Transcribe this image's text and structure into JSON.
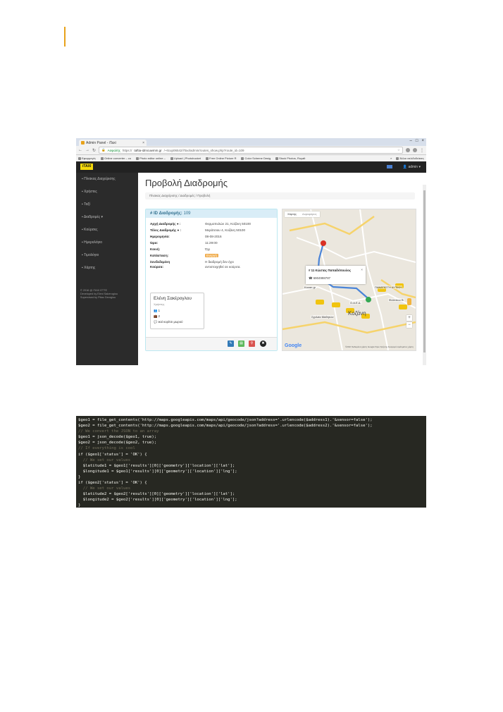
{
  "browser": {
    "tab_title": "Admin Panel - iTaxi",
    "tab_close": "×",
    "window_controls": [
      "–",
      "□",
      "×"
    ],
    "secure_label": "Ασφαλής",
    "url_prefix": "https://",
    "url_host": "taftia-idmcuwmm.gr",
    "url_rest": "/~itcup06542/iTaxi/admin/routes_show.php?route_id=109",
    "bookmarks": [
      "Εφαρμογές",
      "Online converter – co",
      "Photo editor online –",
      "Upload | Photobucket",
      "Free Online Picture R",
      "Color Scheme Desig",
      "Stock Photos, Royalt"
    ],
    "bookmarks_more": "»",
    "bookmarks_other": "Άλλοι σελιδοδείκτες"
  },
  "app": {
    "brand": "iTAXI",
    "user": "admin",
    "sidebar": [
      "Πίνακας Διαχείρισης",
      "Χρήστες",
      "Ταξί",
      "Διαδρομές ▾",
      "Κούρσες",
      "Ημερολόγιο",
      "Τιμολόγιο",
      "Χάρτης"
    ],
    "footer_lines": [
      "© 2016 @ iTAXI ETTE",
      "Developed by Eleni Sakerogiou",
      "Supervised by Pitas Georgiou"
    ],
    "page_title": "Προβολή Διαδρομής",
    "breadcrumb": "Πίνακας Διαχείρισης   /   Διαδρομές   /   Προβολή",
    "panel_label": "# ID Διαδρομής:",
    "panel_id": "109",
    "details": [
      {
        "k": "Αρχή Διαδρομής ● :",
        "v": "Θερμοπυλών 21, Κοζάνη 50100"
      },
      {
        "k": "Τέλος Διαδρομής ● :",
        "v": "Μεράτσιου 4, Κοζάνη 50100"
      },
      {
        "k": "Ημερομηνία:",
        "v": "08-08-2016"
      },
      {
        "k": "Ώρα:",
        "v": "11:29:00"
      },
      {
        "k": "Κοινή:",
        "v": "Όχι"
      },
      {
        "k": "Κατάσταση:",
        "v": "Ενεργή"
      },
      {
        "k": "Συνδεδεμένη",
        "v": "Η διαδρομή δεν έχει"
      },
      {
        "k": "Κούρσα:",
        "v": "αντιστοιχηθεί σε κούρσα."
      }
    ],
    "driver": {
      "name": "Ελένη Σακέρογλου",
      "role": "Χρήστης",
      "line1": "1",
      "line2": "2",
      "line3": "ικοί κορίτσι μωρού"
    },
    "map": {
      "tab_map": "Χάρτης",
      "tab_sat": "Δορυφόρος",
      "info_title": "11 Κώστας Παπαδόπουλος",
      "info_phone": "6904998787",
      "info_close": "×",
      "labels": [
        "ΠΑΝΕΠΙΣΤΗ ΔΥΤΙΚΗ",
        "Φιλίππου Β",
        "Kozan.gr",
        "Ο.Α.Ε.Δ.",
        "Σχολεία Μαθητών"
      ],
      "city": "Κοζάνη",
      "zoom_in": "+",
      "zoom_out": "−",
      "logo": "Google",
      "attribution": "©2017 Δεδομένα χάρτη Google  Όροι Χρήσης  Αναφορά σφάλματος χάρτη"
    }
  },
  "code_lines": [
    {
      "text": "$geo1 = file_get_contents('http://maps.googleapis.com/maps/api/geocode/json?address='.urlencode($address1).'&sensor=false');",
      "type": "code"
    },
    {
      "text": "$geo2 = file_get_contents('http://maps.googleapis.com/maps/api/geocode/json?address='.urlencode($address2).'&sensor=false');",
      "type": "code"
    },
    {
      "text": "// We convert the JSON to an array",
      "type": "comment"
    },
    {
      "text": "$geo1 = json_decode($geo1, true);",
      "type": "code"
    },
    {
      "text": "$geo2 = json_decode($geo2, true);",
      "type": "code"
    },
    {
      "text": "// If everything is cool",
      "type": "comment"
    },
    {
      "text": "if ($geo1['status'] = 'OK') {",
      "type": "code"
    },
    {
      "text": "  // We set our values",
      "type": "comment"
    },
    {
      "text": "  $latitude1 = $geo1['results'][0]['geometry']['location']['lat'];",
      "type": "code"
    },
    {
      "text": "  $longitude1 = $geo1['results'][0]['geometry']['location']['lng'];",
      "type": "code"
    },
    {
      "text": "}",
      "type": "code"
    },
    {
      "text": "if ($geo2['status'] = 'OK') {",
      "type": "code"
    },
    {
      "text": "  // We set our values",
      "type": "comment"
    },
    {
      "text": "  $latitude2 = $geo2['results'][0]['geometry']['location']['lat'];",
      "type": "code"
    },
    {
      "text": "  $longitude2 = $geo2['results'][0]['geometry']['location']['lng'];",
      "type": "code"
    },
    {
      "text": "}",
      "type": "code"
    }
  ]
}
